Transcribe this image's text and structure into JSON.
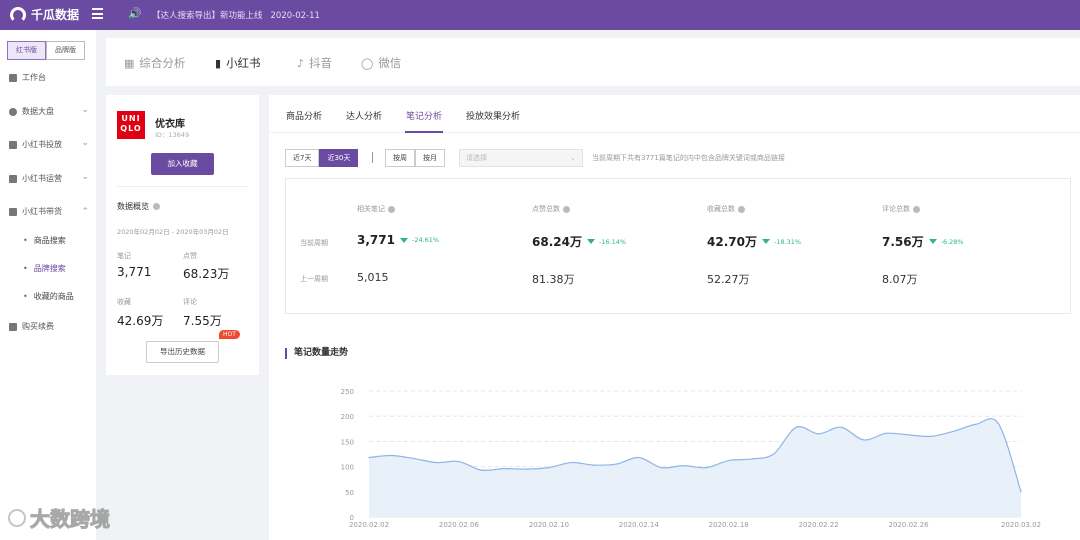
{
  "header": {
    "app_name": "千瓜数据",
    "notice": "【达人搜索导出】新功能上线",
    "notice_date": "2020-02-11"
  },
  "sidebar": {
    "version_tabs": [
      "红书版",
      "品牌版"
    ],
    "items": [
      {
        "label": "工作台",
        "icon": "dashboard-icon"
      },
      {
        "label": "数据大盘",
        "icon": "pie-chart-icon"
      },
      {
        "label": "小红书投放",
        "icon": "ad-icon"
      },
      {
        "label": "小红书运营",
        "icon": "operation-icon"
      },
      {
        "label": "小红书带货",
        "icon": "shopping-bag-icon"
      },
      {
        "label": "购买续费",
        "icon": "cart-icon"
      }
    ],
    "sub_items": [
      "商品搜索",
      "品牌搜索",
      "收藏的商品"
    ]
  },
  "watermark": "大数跨境",
  "platform_tabs": [
    {
      "label": "综合分析",
      "icon": "grid-icon"
    },
    {
      "label": "小红书",
      "icon": "book-icon"
    },
    {
      "label": "抖音",
      "icon": "music-note-icon"
    },
    {
      "label": "微信",
      "icon": "wechat-icon"
    }
  ],
  "brand": {
    "logo_text": "UNIQLO",
    "logo_line1": "UNI",
    "logo_line2": "QLO",
    "name": "优衣库",
    "id_text": "ID：13649",
    "favorite_button": "加入收藏",
    "overview_title": "数据概览",
    "date_range": "2020年02月02日 - 2020年03月02日",
    "stats": [
      {
        "label": "笔记",
        "value": "3,771"
      },
      {
        "label": "点赞",
        "value": "68.23万"
      },
      {
        "label": "收藏",
        "value": "42.69万"
      },
      {
        "label": "评论",
        "value": "7.55万"
      }
    ],
    "export_button": "导出历史数据",
    "hot_badge": "HOT"
  },
  "analysis_tabs": [
    "商品分析",
    "达人分析",
    "笔记分析",
    "投放效果分析"
  ],
  "filters": {
    "range_options": [
      "近7天",
      "近30天"
    ],
    "granularity_options": [
      "按周",
      "按月"
    ],
    "select_placeholder": "请选择",
    "period_note": "当前周期下共有3771篇笔记的内中包含品牌关键词或商品链接"
  },
  "stats_table": {
    "row_current": "当前周期",
    "row_previous": "上一周期",
    "columns": [
      {
        "label": "相关笔记",
        "current": "3,771",
        "change": "-24.61%",
        "previous": "5,015"
      },
      {
        "label": "点赞总数",
        "current": "68.24万",
        "change": "-16.14%",
        "previous": "81.38万"
      },
      {
        "label": "收藏总数",
        "current": "42.70万",
        "change": "-18.31%",
        "previous": "52.27万"
      },
      {
        "label": "评论总数",
        "current": "7.56万",
        "change": "-6.28%",
        "previous": "8.07万"
      }
    ]
  },
  "chart_title": "笔记数量走势",
  "chart_data": {
    "type": "area",
    "title": "笔记数量走势",
    "ylim": [
      0,
      250
    ],
    "yticks": [
      0,
      50,
      100,
      150,
      200,
      250
    ],
    "xtick_labels": [
      "2020.02.02",
      "2020.02.06",
      "2020.02.10",
      "2020.02.14",
      "2020.02.18",
      "2020.02.22",
      "2020.02.26",
      "2020.03.02"
    ],
    "x": [
      "2020.02.02",
      "2020.02.03",
      "2020.02.04",
      "2020.02.05",
      "2020.02.06",
      "2020.02.07",
      "2020.02.08",
      "2020.02.09",
      "2020.02.10",
      "2020.02.11",
      "2020.02.12",
      "2020.02.13",
      "2020.02.14",
      "2020.02.15",
      "2020.02.16",
      "2020.02.17",
      "2020.02.18",
      "2020.02.19",
      "2020.02.20",
      "2020.02.21",
      "2020.02.22",
      "2020.02.23",
      "2020.02.24",
      "2020.02.25",
      "2020.02.26",
      "2020.02.27",
      "2020.02.28",
      "2020.02.29",
      "2020.03.01",
      "2020.03.02"
    ],
    "values": [
      118,
      122,
      116,
      108,
      110,
      93,
      96,
      95,
      98,
      108,
      103,
      105,
      118,
      98,
      102,
      98,
      112,
      115,
      125,
      178,
      165,
      178,
      153,
      166,
      163,
      160,
      170,
      184,
      185,
      50
    ],
    "grid": true,
    "colors": {
      "line": "#8fb5e8",
      "fill": "#e6eefa",
      "grid": "#e0e0e0"
    }
  },
  "colors": {
    "brand": "#6b4aa2",
    "decrease": "#2fb684",
    "hot": "#f04a2f",
    "uniqlo_red": "#e00012"
  }
}
